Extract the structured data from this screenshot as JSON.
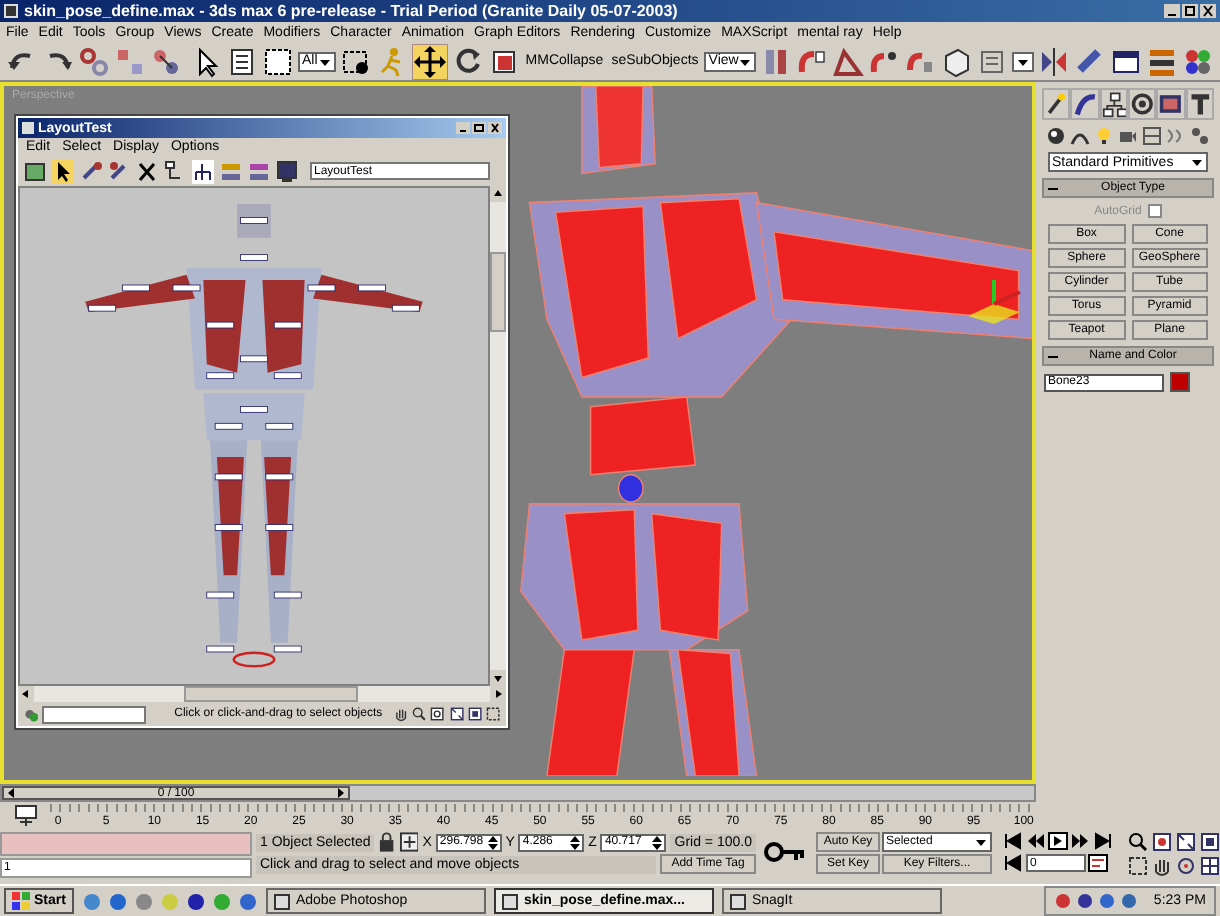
{
  "window": {
    "title": "skin_pose_define.max - 3ds max 6 pre-release - Trial Period (Granite Daily 05-07-2003)"
  },
  "menu": [
    "File",
    "Edit",
    "Tools",
    "Group",
    "Views",
    "Create",
    "Modifiers",
    "Character",
    "Animation",
    "Graph Editors",
    "Rendering",
    "Customize",
    "MAXScript",
    "mental ray",
    "Help"
  ],
  "toolbar": {
    "selection_filter": "All",
    "buttons": [
      "MMCollapse",
      "seSubObjects"
    ],
    "coordinate_system": "View"
  },
  "viewport": {
    "label": "Perspective"
  },
  "layout_window": {
    "title": "LayoutTest",
    "menu": [
      "Edit",
      "Select",
      "Display",
      "Options"
    ],
    "name_field": "LayoutTest",
    "status": "Click or click-and-drag to select objects"
  },
  "command_panel": {
    "category": "Standard Primitives",
    "object_type": {
      "title": "Object Type",
      "autogrid": {
        "label": "AutoGrid",
        "checked": false
      },
      "buttons": [
        "Box",
        "Cone",
        "Sphere",
        "GeoSphere",
        "Cylinder",
        "Tube",
        "Torus",
        "Pyramid",
        "Teapot",
        "Plane"
      ]
    },
    "name_and_color": {
      "title": "Name and Color",
      "name": "Bone23"
    }
  },
  "time_slider": {
    "label": "0 / 100"
  },
  "ruler_ticks": [
    "0",
    "5",
    "10",
    "15",
    "20",
    "25",
    "30",
    "35",
    "40",
    "45",
    "50",
    "55",
    "60",
    "65",
    "70",
    "75",
    "80",
    "85",
    "90",
    "95",
    "100"
  ],
  "status": {
    "listener_value": "1",
    "selection": "1 Object Selected",
    "coordinates": [
      {
        "axis": "X",
        "value": "296.798"
      },
      {
        "axis": "Y",
        "value": "4.286"
      },
      {
        "axis": "Z",
        "value": "40.717"
      }
    ],
    "grid": "Grid = 100.0",
    "prompt": "Click and drag to select and move objects",
    "add_time_tag": "Add Time Tag",
    "auto_key": "Auto Key",
    "key_mode": "Selected",
    "set_key": "Set Key",
    "key_filters": "Key Filters...",
    "frame": "0"
  },
  "taskbar": {
    "start": "Start",
    "tasks": [
      {
        "label": "Adobe Photoshop",
        "selected": false
      },
      {
        "label": "skin_pose_define.max...",
        "selected": true
      },
      {
        "label": "SnagIt",
        "selected": false
      }
    ],
    "clock": "5:23 PM"
  }
}
